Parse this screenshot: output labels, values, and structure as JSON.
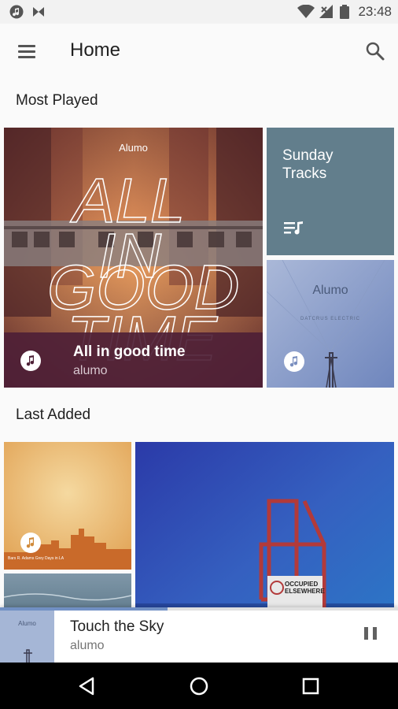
{
  "status_bar": {
    "time": "23:48"
  },
  "app_bar": {
    "title": "Home"
  },
  "sections": {
    "most_played": "Most Played",
    "last_added": "Last Added"
  },
  "most_played": {
    "featured": {
      "art_text_small": "Alumo",
      "art_text_big": "ALL IN GOOD TIME",
      "title": "All in good time",
      "artist": "alumo"
    },
    "playlist": {
      "title": "Sunday Tracks"
    },
    "album2": {
      "art_text": "Alumo",
      "art_subtext": "DATCRUS ELECTRIC"
    }
  },
  "last_added": {
    "album1": {
      "art_text": "Bars R. Adams Grey Days in LA"
    },
    "album3": {
      "sign_text": "OCCUPIED ELSEWHERE"
    }
  },
  "now_playing": {
    "title": "Touch the Sky",
    "artist": "alumo",
    "progress": 0.42,
    "thumb_text": "Alumo"
  }
}
